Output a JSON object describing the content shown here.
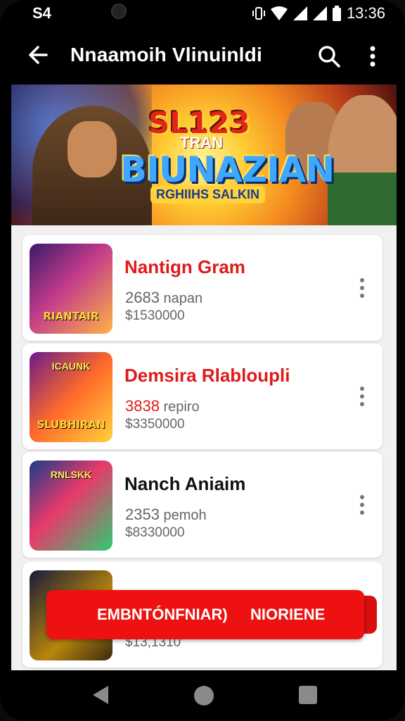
{
  "status": {
    "left_text": "S4",
    "time": "13:36"
  },
  "appbar": {
    "title": "Nnaamoih Vlinuinldi"
  },
  "banner": {
    "logo_top": "SL123",
    "logo_sub": "TRAN",
    "logo_main": "BIUNAZIAN",
    "logo_tag": "RGHIIHS SALKIN"
  },
  "list": [
    {
      "title": "Nantign Gram",
      "title_color": "#e01a1a",
      "meta_num": "2683",
      "meta_text": "napan",
      "meta_num_color": "#666666",
      "price": "$1530000",
      "thumb_text": "RIANTAIR",
      "thumb_top": "",
      "thumb_bg": "linear-gradient(135deg,#3a1a6a,#c23b8a 45%,#ffb347)"
    },
    {
      "title": "Demsira Rlabloupli",
      "title_color": "#e01a1a",
      "meta_num": "3838",
      "meta_text": "repiro",
      "meta_num_color": "#e01a1a",
      "price": "$3350000",
      "thumb_text": "SLUBHIRAN",
      "thumb_top": "ICAUNK",
      "thumb_bg": "linear-gradient(135deg,#6a1a8a,#ff6a2a 50%,#ffd23a)"
    },
    {
      "title": "Nanch Aniaim",
      "title_color": "#111111",
      "meta_num": "2353",
      "meta_text": "pemoh",
      "meta_num_color": "#666666",
      "price": "$8330000",
      "thumb_text": "",
      "thumb_top": "RNLSKK",
      "thumb_bg": "linear-gradient(135deg,#1a3a8a,#e83a6a 45%,#2ecc71)"
    },
    {
      "title": "",
      "title_color": "#e01a1a",
      "meta_num": "",
      "meta_text": "",
      "meta_num_color": "#666666",
      "price": "$13,1310",
      "thumb_text": "",
      "thumb_top": "",
      "thumb_bg": "linear-gradient(135deg,#1a1a3a,#b8860b 60%,#3a2a10)"
    }
  ],
  "cta": {
    "left_label": "EMBNTÓNFNIAR)",
    "right_label": "NIORIENE"
  },
  "icons": {
    "back": "arrow-left-icon",
    "search": "search-icon",
    "more": "more-vert-icon"
  }
}
